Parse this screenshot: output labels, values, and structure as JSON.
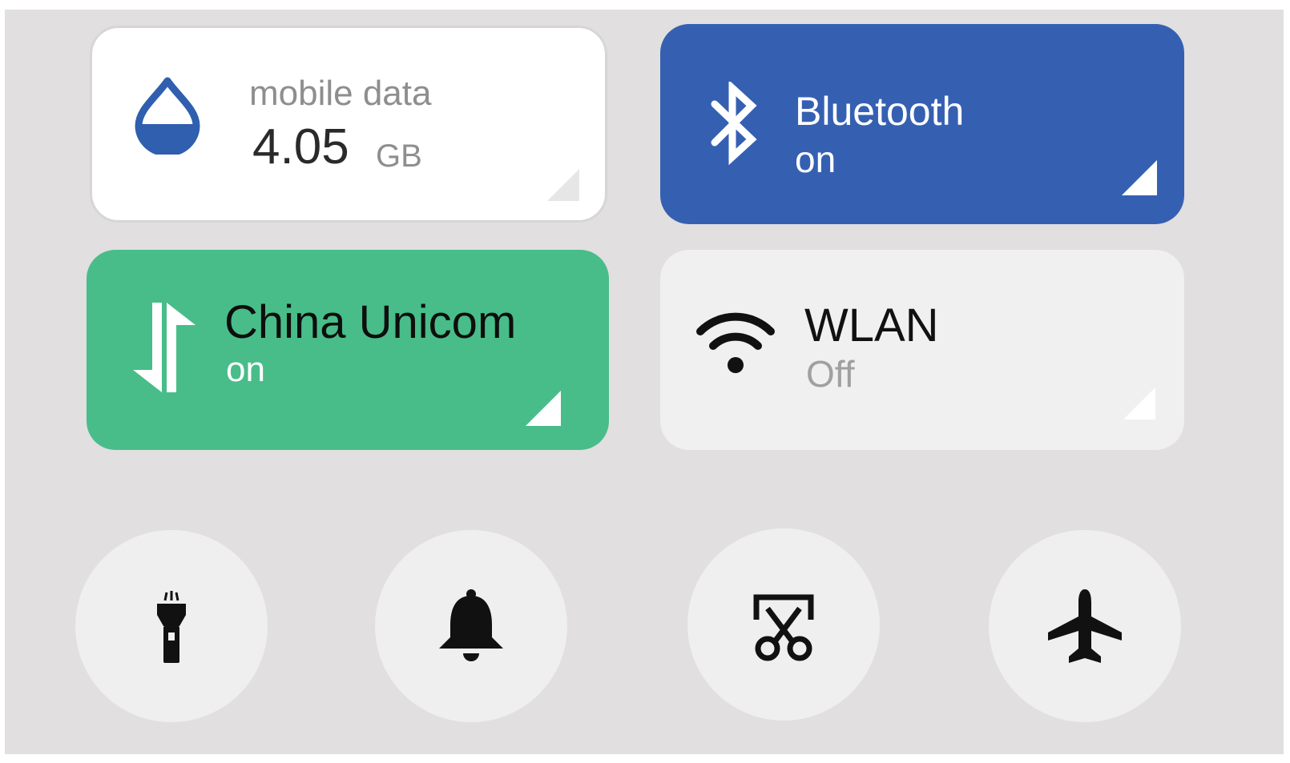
{
  "tiles": {
    "mobile_data": {
      "label": "mobile data",
      "value": "4.05",
      "unit": "GB",
      "icon": "water-drop-icon"
    },
    "bluetooth": {
      "label": "Bluetooth",
      "status": "on",
      "icon": "bluetooth-icon",
      "color": "#3560b2"
    },
    "cellular": {
      "label": "China Unicom",
      "status": "on",
      "icon": "data-transfer-arrows-icon",
      "color": "#48bd89"
    },
    "wlan": {
      "label": "WLAN",
      "status": "Off",
      "icon": "wifi-icon"
    }
  },
  "toggles": [
    {
      "name": "flashlight",
      "icon": "flashlight-icon"
    },
    {
      "name": "sound",
      "icon": "bell-icon"
    },
    {
      "name": "screenshot",
      "icon": "screenshot-scissors-icon"
    },
    {
      "name": "airplane-mode",
      "icon": "airplane-icon"
    }
  ],
  "colors": {
    "background": "#e1dfdf",
    "accent_blue": "#3560b2",
    "accent_green": "#48bd89",
    "inactive_tile": "#f0f0f0",
    "round_button": "#efefef"
  }
}
